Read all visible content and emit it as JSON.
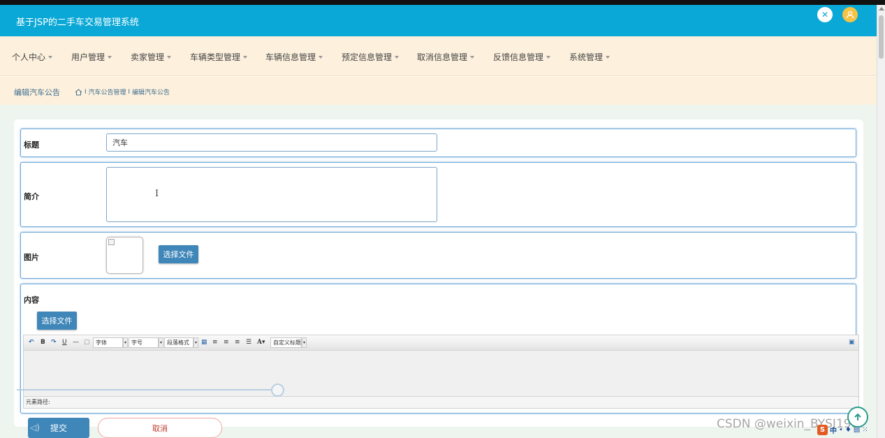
{
  "app": {
    "title": "基于JSP的二手车交易管理系统"
  },
  "header_icons": [
    "fullscreen-icon",
    "user-avatar-icon"
  ],
  "nav": [
    {
      "label": "个人中心"
    },
    {
      "label": "用户管理"
    },
    {
      "label": "卖家管理"
    },
    {
      "label": "车辆类型管理"
    },
    {
      "label": "车辆信息管理"
    },
    {
      "label": "预定信息管理"
    },
    {
      "label": "取消信息管理"
    },
    {
      "label": "反馈信息管理"
    },
    {
      "label": "系统管理"
    }
  ],
  "breadcrumb": {
    "page_title": "编辑汽车公告",
    "crumb1": "汽车公告管理",
    "crumb2": "编辑汽车公告",
    "separator": "I"
  },
  "form": {
    "title_label": "标题",
    "title_value": "汽车",
    "intro_label": "简介",
    "intro_value": "",
    "image_label": "图片",
    "choose_file_label": "选择文件",
    "content_label": "内容",
    "content_choose_file_label": "选择文件"
  },
  "editor": {
    "font_family": "字体",
    "font_size": "字号",
    "paragraph": "段落格式",
    "custom_heading": "自定义标题",
    "status_label": "元素路径:",
    "bold": "B",
    "underline": "U",
    "font_color": "A"
  },
  "actions": {
    "submit_label": "提交",
    "cancel_label": "取消"
  },
  "overlay": {
    "watermark": "CSDN @weixin_BYSJ1987",
    "ime_s": "S",
    "ime_lang": "中"
  },
  "colors": {
    "header": "#0aa8d6",
    "nav_bg": "#fdf0dd",
    "content_bg": "#eef5ef",
    "primary_button": "#3f86b9",
    "cancel_text": "#c0392b"
  }
}
